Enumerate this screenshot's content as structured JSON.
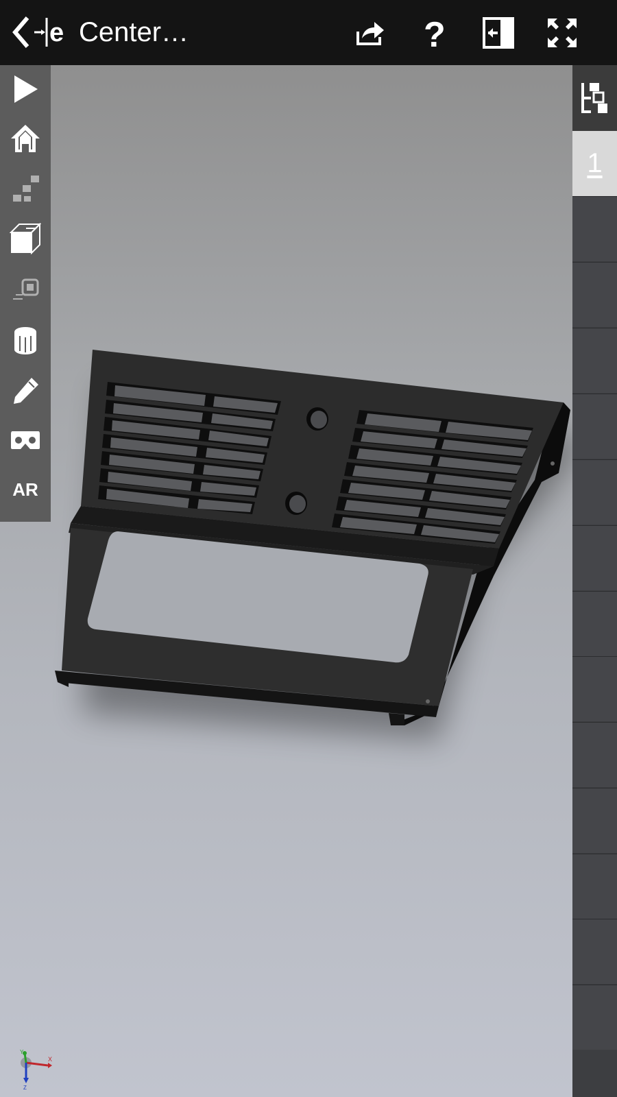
{
  "header": {
    "title": "Center…",
    "back_icon": "back-arrow-icon",
    "actions": [
      {
        "name": "share",
        "icon": "share-icon"
      },
      {
        "name": "help",
        "icon": "help-icon"
      },
      {
        "name": "collapse",
        "icon": "collapse-panel-icon"
      },
      {
        "name": "fullscreen",
        "icon": "fullscreen-icon"
      }
    ]
  },
  "left_toolbar": {
    "items": [
      {
        "name": "play",
        "icon": "play-icon"
      },
      {
        "name": "home",
        "icon": "home-icon"
      },
      {
        "name": "explode",
        "icon": "explode-steps-icon"
      },
      {
        "name": "view-cube",
        "icon": "view-cube-icon"
      },
      {
        "name": "section",
        "icon": "section-icon"
      },
      {
        "name": "measure",
        "icon": "measure-icon"
      },
      {
        "name": "markup",
        "icon": "pencil-icon"
      },
      {
        "name": "vr",
        "icon": "vr-headset-icon"
      },
      {
        "name": "ar",
        "label": "AR"
      }
    ]
  },
  "right_panel": {
    "tree_icon": "assembly-tree-icon",
    "active_page": "1"
  },
  "viewport": {
    "axis": {
      "x": "X",
      "y": "Y",
      "z": "Z"
    }
  },
  "colors": {
    "topbar": "#141414",
    "toolbar": "#5c5c5c",
    "panel": "#3d3e41",
    "active_cell": "#d9d9d9",
    "part": "#2c2c2c"
  }
}
